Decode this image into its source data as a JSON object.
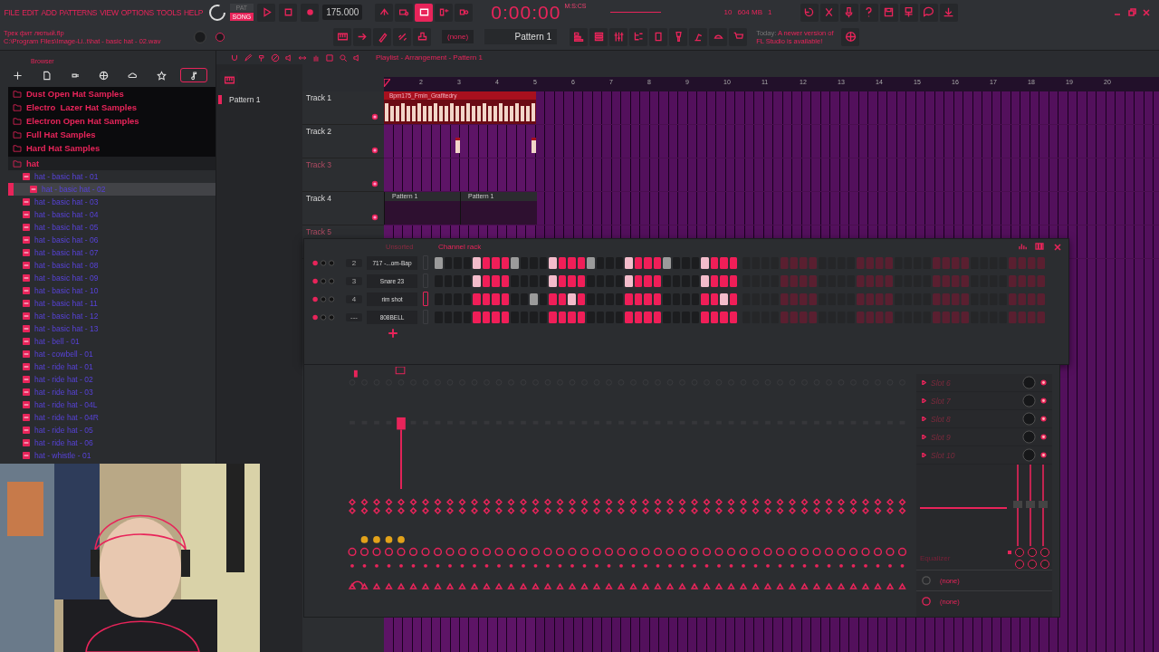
{
  "menu": [
    "FILE",
    "EDIT",
    "ADD",
    "PATTERNS",
    "VIEW",
    "OPTIONS",
    "TOOLS",
    "HELP"
  ],
  "transport": {
    "mode": [
      {
        "label": "PAT",
        "selected": false
      },
      {
        "label": "SONG",
        "selected": true
      }
    ],
    "tempo": "175.000",
    "time": "0:00:00",
    "time_unit": "M:S:CS"
  },
  "monitor": {
    "cpu": "10",
    "memory": "604 MB",
    "polyphony": "1"
  },
  "hint": {
    "project": "Трек фит лютый.flp",
    "path": "C:\\Program Files\\Image-Li..t\\hat - basic hat - 02.wav"
  },
  "pattern_selector": {
    "snap": "(none)",
    "pattern": "Pattern 1"
  },
  "news": {
    "prefix": "Today:",
    "text": "A newer version of FL Studio is available!"
  },
  "browser": {
    "title": "Browser",
    "tabs": [
      {
        "kind": "plus",
        "selected": false
      },
      {
        "kind": "file",
        "selected": false
      },
      {
        "kind": "plug",
        "selected": false
      },
      {
        "kind": "globe",
        "selected": false
      },
      {
        "kind": "cloud",
        "selected": false
      },
      {
        "kind": "star",
        "selected": false
      },
      {
        "kind": "note",
        "selected": true
      }
    ],
    "folders": [
      {
        "label": "Dust Open Hat Samples",
        "expanded": false
      },
      {
        "label": "Electro  Lazer Hat Samples",
        "expanded": false
      },
      {
        "label": "Electron Open Hat Samples",
        "expanded": false
      },
      {
        "label": "Full Hat Samples",
        "expanded": false
      },
      {
        "label": "Hard Hat Samples",
        "expanded": false
      },
      {
        "label": "hat",
        "expanded": true,
        "children": [
          {
            "label": "hat - basic hat - 01",
            "selected": false
          },
          {
            "label": "hat - basic hat - 02",
            "selected": true
          },
          {
            "label": "hat - basic hat - 03",
            "selected": false
          },
          {
            "label": "hat - basic hat - 04",
            "selected": false
          },
          {
            "label": "hat - basic hat - 05",
            "selected": false
          },
          {
            "label": "hat - basic hat - 06",
            "selected": false
          },
          {
            "label": "hat - basic hat - 07",
            "selected": false
          },
          {
            "label": "hat - basic hat - 08",
            "selected": false
          },
          {
            "label": "hat - basic hat - 09",
            "selected": false
          },
          {
            "label": "hat - basic hat - 10",
            "selected": false
          },
          {
            "label": "hat - basic hat - 11",
            "selected": false
          },
          {
            "label": "hat - basic hat - 12",
            "selected": false
          },
          {
            "label": "hat - basic hat - 13",
            "selected": false
          },
          {
            "label": "hat - bell - 01",
            "selected": false
          },
          {
            "label": "hat - cowbell - 01",
            "selected": false
          },
          {
            "label": "hat - ride hat - 01",
            "selected": false
          },
          {
            "label": "hat - ride hat - 02",
            "selected": false
          },
          {
            "label": "hat - ride hat - 03",
            "selected": false
          },
          {
            "label": "hat - ride hat - 04L",
            "selected": false
          },
          {
            "label": "hat - ride hat - 04R",
            "selected": false
          },
          {
            "label": "hat - ride hat - 05",
            "selected": false
          },
          {
            "label": "hat - ride hat - 06",
            "selected": false
          },
          {
            "label": "hat - whistle - 01",
            "selected": false
          }
        ]
      }
    ]
  },
  "playlist": {
    "title": "Playlist - Arrangement - Pattern 1",
    "patterns": [
      "Pattern 1"
    ],
    "bars": [
      "2",
      "3",
      "4",
      "5",
      "6",
      "7",
      "8",
      "9",
      "10",
      "11",
      "12",
      "13",
      "14",
      "15",
      "16",
      "17",
      "18",
      "19",
      "20"
    ],
    "tracks": [
      {
        "name": "Track 1",
        "enabled": true,
        "clips": [
          {
            "kind": "audio",
            "label": "Bpm175_Fmin_Grafitedry"
          }
        ]
      },
      {
        "name": "Track 2",
        "enabled": true,
        "clips": [
          {
            "kind": "slice"
          },
          {
            "kind": "slice"
          }
        ]
      },
      {
        "name": "Track 3",
        "enabled": false
      },
      {
        "name": "Track 4",
        "enabled": true,
        "clips": [
          {
            "kind": "pattern",
            "label": "Pattern 1"
          },
          {
            "kind": "pattern",
            "label": "Pattern 1"
          }
        ]
      },
      {
        "name": "Track 5",
        "enabled": false
      }
    ]
  },
  "channel_rack": {
    "filter": "Unsorted",
    "title": "Channel rack",
    "channels": [
      {
        "number": "2",
        "name": "717 -...om-Bap",
        "selected": false,
        "steps": [
          {
            "on": false,
            "highlighted": true
          },
          {
            "on": false,
            "highlighted": false
          },
          {
            "on": false,
            "highlighted": false
          },
          {
            "on": false,
            "highlighted": false
          },
          {
            "on": true,
            "highlighted": true
          },
          {
            "on": true,
            "highlighted": false
          },
          {
            "on": true,
            "highlighted": false
          },
          {
            "on": true,
            "highlighted": false
          },
          {
            "on": false,
            "highlighted": true
          },
          {
            "on": false,
            "highlighted": false
          },
          {
            "on": false,
            "highlighted": false
          },
          {
            "on": false,
            "highlighted": false
          },
          {
            "on": true,
            "highlighted": true
          },
          {
            "on": true,
            "highlighted": false
          },
          {
            "on": true,
            "highlighted": false
          },
          {
            "on": true,
            "highlighted": false
          },
          {
            "on": false,
            "highlighted": true
          },
          {
            "on": false,
            "highlighted": false
          },
          {
            "on": false,
            "highlighted": false
          },
          {
            "on": false,
            "highlighted": false
          },
          {
            "on": true,
            "highlighted": true
          },
          {
            "on": true,
            "highlighted": false
          },
          {
            "on": true,
            "highlighted": false
          },
          {
            "on": true,
            "highlighted": false
          },
          {
            "on": false,
            "highlighted": true
          },
          {
            "on": false,
            "highlighted": false
          },
          {
            "on": false,
            "highlighted": false
          },
          {
            "on": false,
            "highlighted": false
          },
          {
            "on": true,
            "highlighted": true
          },
          {
            "on": true,
            "highlighted": false
          },
          {
            "on": true,
            "highlighted": false
          },
          {
            "on": true,
            "highlighted": false
          }
        ]
      },
      {
        "number": "3",
        "name": "Snare 23",
        "selected": false,
        "steps": [
          {
            "on": false,
            "highlighted": false
          },
          {
            "on": false,
            "highlighted": false
          },
          {
            "on": false,
            "highlighted": false
          },
          {
            "on": false,
            "highlighted": false
          },
          {
            "on": true,
            "highlighted": true
          },
          {
            "on": true,
            "highlighted": false
          },
          {
            "on": true,
            "highlighted": false
          },
          {
            "on": true,
            "highlighted": false
          },
          {
            "on": false,
            "highlighted": false
          },
          {
            "on": false,
            "highlighted": false
          },
          {
            "on": false,
            "highlighted": false
          },
          {
            "on": false,
            "highlighted": false
          },
          {
            "on": true,
            "highlighted": true
          },
          {
            "on": true,
            "highlighted": false
          },
          {
            "on": true,
            "highlighted": false
          },
          {
            "on": true,
            "highlighted": false
          },
          {
            "on": false,
            "highlighted": false
          },
          {
            "on": false,
            "highlighted": false
          },
          {
            "on": false,
            "highlighted": false
          },
          {
            "on": false,
            "highlighted": false
          },
          {
            "on": true,
            "highlighted": true
          },
          {
            "on": true,
            "highlighted": false
          },
          {
            "on": true,
            "highlighted": false
          },
          {
            "on": true,
            "highlighted": false
          },
          {
            "on": false,
            "highlighted": false
          },
          {
            "on": false,
            "highlighted": false
          },
          {
            "on": false,
            "highlighted": false
          },
          {
            "on": false,
            "highlighted": false
          },
          {
            "on": true,
            "highlighted": true
          },
          {
            "on": true,
            "highlighted": false
          },
          {
            "on": true,
            "highlighted": false
          },
          {
            "on": true,
            "highlighted": false
          }
        ]
      },
      {
        "number": "4",
        "name": "rim shot",
        "selected": true,
        "steps": [
          {
            "on": false,
            "highlighted": false
          },
          {
            "on": false,
            "highlighted": false
          },
          {
            "on": false,
            "highlighted": false
          },
          {
            "on": false,
            "highlighted": false
          },
          {
            "on": true,
            "highlighted": false
          },
          {
            "on": true,
            "highlighted": false
          },
          {
            "on": true,
            "highlighted": false
          },
          {
            "on": true,
            "highlighted": false
          },
          {
            "on": false,
            "highlighted": false
          },
          {
            "on": false,
            "highlighted": false
          },
          {
            "on": false,
            "highlighted": true
          },
          {
            "on": false,
            "highlighted": false
          },
          {
            "on": true,
            "highlighted": false
          },
          {
            "on": true,
            "highlighted": false
          },
          {
            "on": true,
            "highlighted": true
          },
          {
            "on": true,
            "highlighted": false
          },
          {
            "on": false,
            "highlighted": false
          },
          {
            "on": false,
            "highlighted": false
          },
          {
            "on": false,
            "highlighted": false
          },
          {
            "on": false,
            "highlighted": false
          },
          {
            "on": true,
            "highlighted": false
          },
          {
            "on": true,
            "highlighted": false
          },
          {
            "on": true,
            "highlighted": false
          },
          {
            "on": true,
            "highlighted": false
          },
          {
            "on": false,
            "highlighted": false
          },
          {
            "on": false,
            "highlighted": false
          },
          {
            "on": false,
            "highlighted": false
          },
          {
            "on": false,
            "highlighted": false
          },
          {
            "on": true,
            "highlighted": false
          },
          {
            "on": true,
            "highlighted": false
          },
          {
            "on": true,
            "highlighted": true
          },
          {
            "on": true,
            "highlighted": false
          }
        ]
      },
      {
        "number": "---",
        "name": "808BELL",
        "selected": false,
        "steps": [
          {
            "on": false,
            "highlighted": false
          },
          {
            "on": false,
            "highlighted": false
          },
          {
            "on": false,
            "highlighted": false
          },
          {
            "on": false,
            "highlighted": false
          },
          {
            "on": true,
            "highlighted": false
          },
          {
            "on": true,
            "highlighted": false
          },
          {
            "on": true,
            "highlighted": false
          },
          {
            "on": true,
            "highlighted": false
          },
          {
            "on": false,
            "highlighted": false
          },
          {
            "on": false,
            "highlighted": false
          },
          {
            "on": false,
            "highlighted": false
          },
          {
            "on": false,
            "highlighted": false
          },
          {
            "on": true,
            "highlighted": false
          },
          {
            "on": true,
            "highlighted": false
          },
          {
            "on": true,
            "highlighted": false
          },
          {
            "on": true,
            "highlighted": false
          },
          {
            "on": false,
            "highlighted": false
          },
          {
            "on": false,
            "highlighted": false
          },
          {
            "on": false,
            "highlighted": false
          },
          {
            "on": false,
            "highlighted": false
          },
          {
            "on": true,
            "highlighted": false
          },
          {
            "on": true,
            "highlighted": false
          },
          {
            "on": true,
            "highlighted": false
          },
          {
            "on": true,
            "highlighted": false
          },
          {
            "on": false,
            "highlighted": false
          },
          {
            "on": false,
            "highlighted": false
          },
          {
            "on": false,
            "highlighted": false
          },
          {
            "on": false,
            "highlighted": false
          },
          {
            "on": true,
            "highlighted": false
          },
          {
            "on": true,
            "highlighted": false
          },
          {
            "on": true,
            "highlighted": false
          },
          {
            "on": true,
            "highlighted": false
          }
        ]
      }
    ]
  },
  "mixer": {
    "slots": [
      "Slot 6",
      "Slot 7",
      "Slot 8",
      "Slot 9",
      "Slot 10"
    ],
    "effect": "Equalizer",
    "routing": [
      "(none)",
      "(none)"
    ]
  }
}
